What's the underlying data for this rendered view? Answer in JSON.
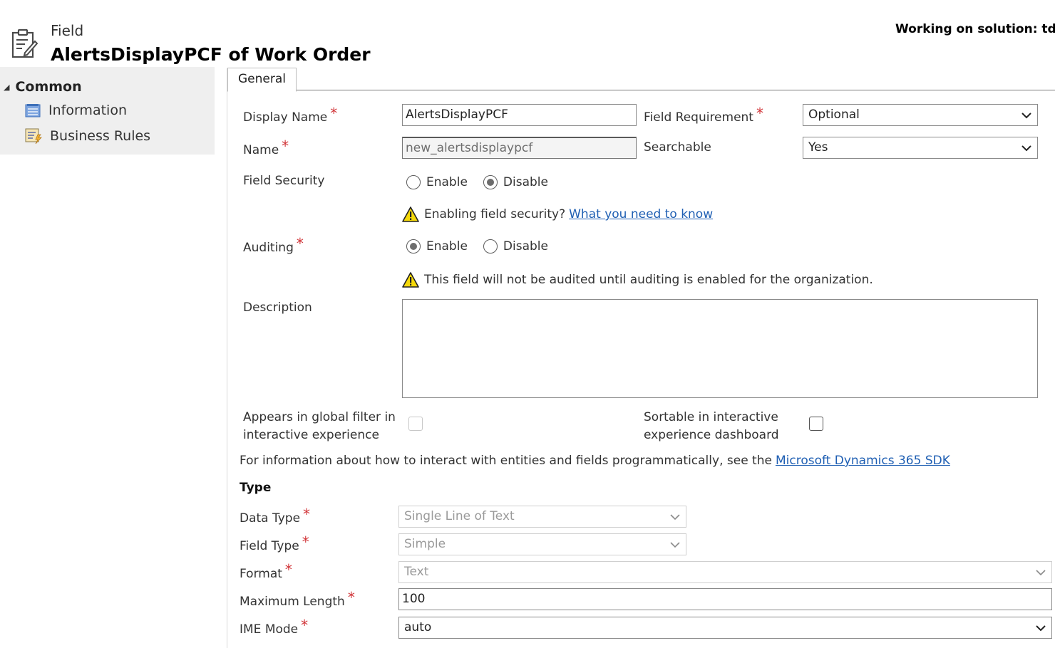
{
  "header": {
    "entity_label": "Field",
    "title": "AlertsDisplayPCF of Work Order",
    "solution": "Working on solution: tdayr",
    "icon": "field-form-icon"
  },
  "sidebar": {
    "group_label": "Common",
    "items": [
      {
        "label": "Information",
        "icon": "information-icon"
      },
      {
        "label": "Business Rules",
        "icon": "business-rules-icon"
      }
    ]
  },
  "tabs": [
    {
      "label": "General",
      "active": true
    }
  ],
  "form": {
    "display_name": {
      "label": "Display Name",
      "required": "*",
      "value": "AlertsDisplayPCF"
    },
    "name": {
      "label": "Name",
      "required": "*",
      "value": "new_alertsdisplaypcf"
    },
    "field_requirement": {
      "label": "Field Requirement",
      "required": "*",
      "value": "Optional"
    },
    "searchable": {
      "label": "Searchable",
      "value": "Yes"
    },
    "field_security": {
      "label": "Field Security",
      "options": [
        "Enable",
        "Disable"
      ],
      "selected": "Disable",
      "warning": "Enabling field security?",
      "warning_link": "What you need to know"
    },
    "auditing": {
      "label": "Auditing",
      "required": "*",
      "options": [
        "Enable",
        "Disable"
      ],
      "selected": "Enable",
      "warning": "This field will not be audited until auditing is enabled for the organization."
    },
    "description": {
      "label": "Description",
      "value": ""
    },
    "global_filter": {
      "label_line1": "Appears in global filter in",
      "label_line2": "interactive experience",
      "checked": false,
      "disabled": true
    },
    "sortable": {
      "label_line1": "Sortable in interactive",
      "label_line2": "experience dashboard",
      "checked": false
    },
    "sdk_note": "For information about how to interact with entities and fields programmatically, see the",
    "sdk_link": "Microsoft Dynamics 365 SDK"
  },
  "type_section": {
    "title": "Type",
    "data_type": {
      "label": "Data Type",
      "required": "*",
      "value": "Single Line of Text"
    },
    "field_type": {
      "label": "Field Type",
      "required": "*",
      "value": "Simple"
    },
    "format": {
      "label": "Format",
      "required": "*",
      "value": "Text"
    },
    "max_length": {
      "label": "Maximum Length",
      "required": "*",
      "value": "100"
    },
    "ime_mode": {
      "label": "IME Mode",
      "required": "*",
      "value": "auto"
    }
  },
  "colors": {
    "required": "#d13438",
    "link": "#1f5fb3",
    "sidebar_bg": "#efefef",
    "warning": "#f5d90a"
  }
}
